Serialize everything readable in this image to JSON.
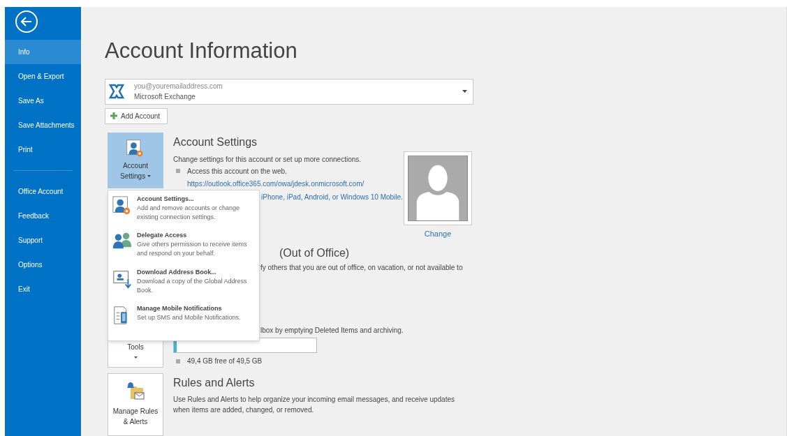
{
  "sidebar": {
    "groups": [
      [
        {
          "label": "Info",
          "selected": true
        },
        {
          "label": "Open & Export",
          "selected": false
        },
        {
          "label": "Save As",
          "selected": false
        },
        {
          "label": "Save Attachments",
          "selected": false
        },
        {
          "label": "Print",
          "selected": false
        }
      ],
      [
        {
          "label": "Office Account",
          "selected": false
        },
        {
          "label": "Feedback",
          "selected": false
        },
        {
          "label": "Support",
          "selected": false
        },
        {
          "label": "Options",
          "selected": false
        },
        {
          "label": "Exit",
          "selected": false
        }
      ]
    ]
  },
  "title": "Account Information",
  "account_selector": {
    "email": "you@youremailaddress.com",
    "type": "Microsoft Exchange"
  },
  "add_account": "Add Account",
  "account_settings": {
    "tile": "Account Settings",
    "heading": "Account Settings",
    "description": "Change settings for this account or set up more connections.",
    "bullet": "Access this account on the web.",
    "link": "https://outlook.office365.com/owa/jdesk.onmicrosoft.com/",
    "mobile_link": "iPhone, iPad, Android, or Windows 10 Mobile.",
    "photo_action": "Change"
  },
  "automatic_replies": {
    "heading": "(Out of Office)",
    "description": "fy others that you are out of office, on vacation, or not available to"
  },
  "mailbox": {
    "tile": "Tools",
    "description": "lbox by emptying Deleted Items and archiving.",
    "level": 0.02,
    "usage": "49,4 GB free of 49,5 GB"
  },
  "rules": {
    "tile": "Manage Rules & Alerts",
    "heading": "Rules and Alerts",
    "description": "Use Rules and Alerts to help organize your incoming email messages, and receive updates when items are added, changed, or removed."
  },
  "menu": {
    "items": [
      {
        "kind": "settings",
        "title": "Account Settings...",
        "description": "Add and remove accounts or change existing connection settings."
      },
      {
        "kind": "delegate",
        "title": "Delegate Access",
        "description": "Give others permission to receive items and respond on your behalf."
      },
      {
        "kind": "addressbook",
        "title": "Download Address Book...",
        "description": "Download a copy of the Global Address Book."
      },
      {
        "kind": "mobile",
        "title": "Manage Mobile Notifications",
        "description": "Set up SMS and Mobile Notifications."
      }
    ]
  }
}
